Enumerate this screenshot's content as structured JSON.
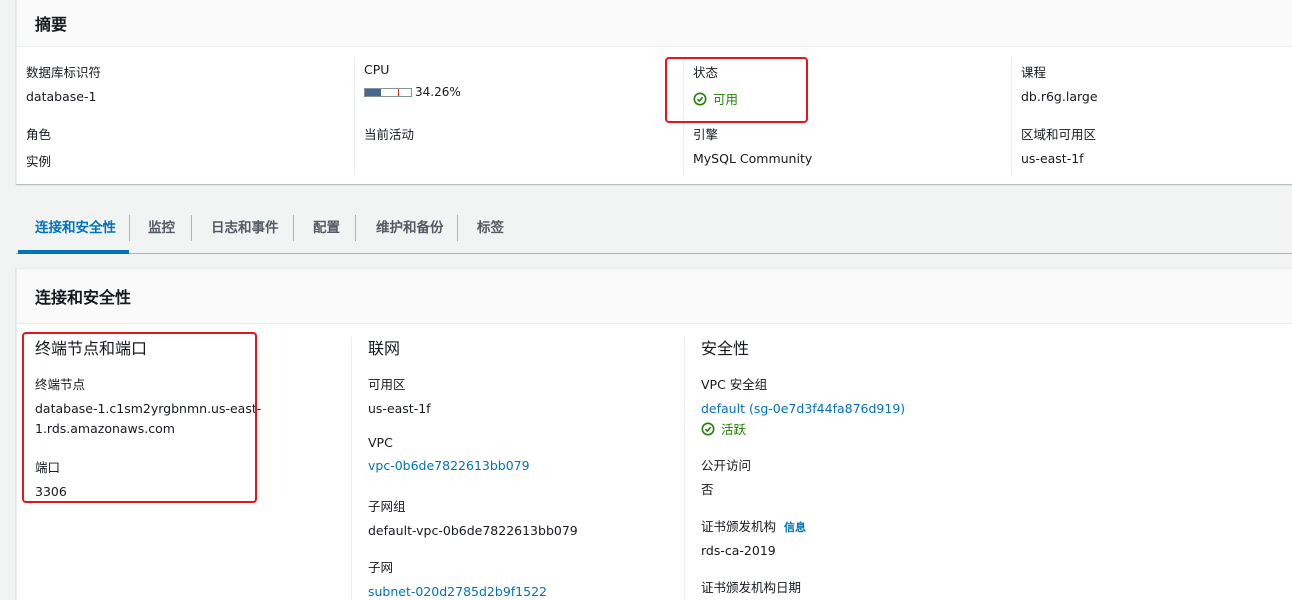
{
  "summary": {
    "title": "摘要",
    "db_identifier": {
      "label": "数据库标识符",
      "value": "database-1"
    },
    "cpu": {
      "label": "CPU",
      "value_text": "34.26%",
      "percent": 34.26
    },
    "status": {
      "label": "状态",
      "value": "可用"
    },
    "class": {
      "label": "课程",
      "value": "db.r6g.large"
    },
    "role": {
      "label": "角色",
      "value": "实例"
    },
    "current_activity": {
      "label": "当前活动"
    },
    "engine": {
      "label": "引擎",
      "value": "MySQL Community"
    },
    "region_az": {
      "label": "区域和可用区",
      "value": "us-east-1f"
    }
  },
  "tabs": [
    {
      "label": "连接和安全性",
      "active": true
    },
    {
      "label": "监控"
    },
    {
      "label": "日志和事件"
    },
    {
      "label": "配置"
    },
    {
      "label": "维护和备份"
    },
    {
      "label": "标签"
    }
  ],
  "connectivity": {
    "title": "连接和安全性",
    "endpoint_port": {
      "heading": "终端节点和端口",
      "endpoint_label": "终端节点",
      "endpoint_line1": "database-1.c1sm2yrgbnmn.us-east-",
      "endpoint_line2": "1.rds.amazonaws.com",
      "port_label": "端口",
      "port_value": "3306"
    },
    "networking": {
      "heading": "联网",
      "az_label": "可用区",
      "az_value": "us-east-1f",
      "vpc_label": "VPC",
      "vpc_value": "vpc-0b6de7822613bb079",
      "subnet_group_label": "子网组",
      "subnet_group_value": "default-vpc-0b6de7822613bb079",
      "subnet_label": "子网",
      "subnet_value": "subnet-020d2785d2b9f1522"
    },
    "security": {
      "heading": "安全性",
      "vpc_sg_label": "VPC 安全组",
      "vpc_sg_value": "default (sg-0e7d3f44fa876d919)",
      "vpc_sg_status": "活跃",
      "public_access_label": "公开访问",
      "public_access_value": "否",
      "ca_label": "证书颁发机构",
      "ca_info": "信息",
      "ca_value": "rds-ca-2019",
      "ca_date_label": "证书颁发机构日期"
    }
  },
  "colors": {
    "link": "#0073bb",
    "success": "#1d8102",
    "highlight": "#e3161c"
  }
}
